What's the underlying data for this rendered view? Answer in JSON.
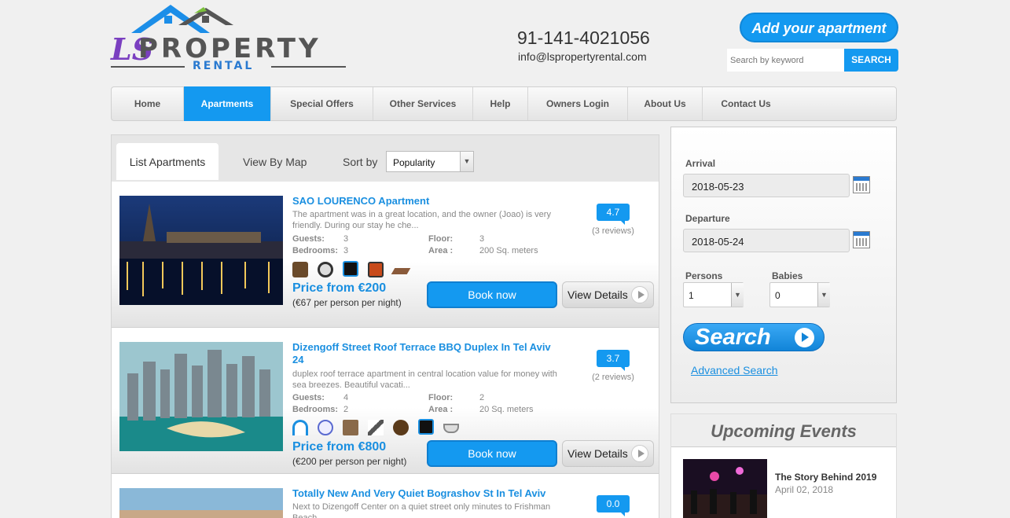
{
  "header": {
    "logo_ls": "LS",
    "logo_main": "PROPERTY",
    "logo_sub": "RENTAL",
    "phone": "91-141-4021056",
    "email": "info@lspropertyrental.com",
    "add_button": "Add your apartment",
    "search_placeholder": "Search by keyword",
    "search_button": "SEARCH"
  },
  "nav": {
    "items": [
      {
        "label": "Home"
      },
      {
        "label": "Apartments"
      },
      {
        "label": "Special Offers"
      },
      {
        "label": "Other Services"
      },
      {
        "label": "Help"
      },
      {
        "label": "Owners Login"
      },
      {
        "label": "About Us"
      },
      {
        "label": "Contact Us"
      }
    ],
    "active": "Apartments"
  },
  "list": {
    "tab_list": "List Apartments",
    "tab_map": "View By Map",
    "sort_label": "Sort by",
    "sort_value": "Popularity",
    "labels": {
      "guests": "Guests:",
      "bedrooms": "Bedrooms:",
      "floor": "Floor:",
      "area": "Area :",
      "book": "Book now",
      "details": "View Details"
    },
    "apartments": [
      {
        "title": "SAO LOURENCO Apartment",
        "desc": "The apartment was in a great location, and the owner (Joao) is very friendly. During our stay he che...",
        "guests": "3",
        "bedrooms": "3",
        "floor": "3",
        "area": "200 Sq. meters",
        "rating": "4.7",
        "reviews": "(3 reviews)",
        "price": "Price from €200",
        "price_sub": "(€67 per person per night)",
        "amenities": [
          "iron-icon",
          "washer-icon",
          "hairdryer-icon",
          "microwave-icon",
          "floor-icon"
        ]
      },
      {
        "title": "Dizengoff Street Roof Terrace BBQ Duplex In Tel Aviv 24",
        "desc": "duplex roof terrace apartment in central location value for money with sea breezes. Beautiful vacati...",
        "guests": "4",
        "bedrooms": "2",
        "floor": "2",
        "area": "20 Sq. meters",
        "rating": "3.7",
        "reviews": "(2 reviews)",
        "price": "Price from €800",
        "price_sub": "(€200 per person per night)",
        "amenities": [
          "wifi-icon",
          "phone-icon",
          "safe-icon",
          "hairdryer-icon",
          "coffee-icon",
          "dryer-icon",
          "bathtub-icon"
        ]
      },
      {
        "title": "Totally New And Very Quiet Bograshov St In Tel Aviv",
        "desc": "Next to Dizengoff Center on a quiet street only minutes to Frishman Beach...",
        "rating": "0.0"
      }
    ]
  },
  "booking": {
    "arrival_label": "Arrival",
    "arrival_value": "2018-05-23",
    "departure_label": "Departure",
    "departure_value": "2018-05-24",
    "persons_label": "Persons",
    "persons_value": "1",
    "babies_label": "Babies",
    "babies_value": "0",
    "search_button": "Search",
    "advanced": "Advanced Search"
  },
  "events": {
    "heading": "Upcoming Events",
    "items": [
      {
        "title": "The Story Behind 2019",
        "date": "April 02, 2018"
      }
    ]
  },
  "colors": {
    "accent": "#1499f0",
    "link": "#1a8fe0"
  }
}
